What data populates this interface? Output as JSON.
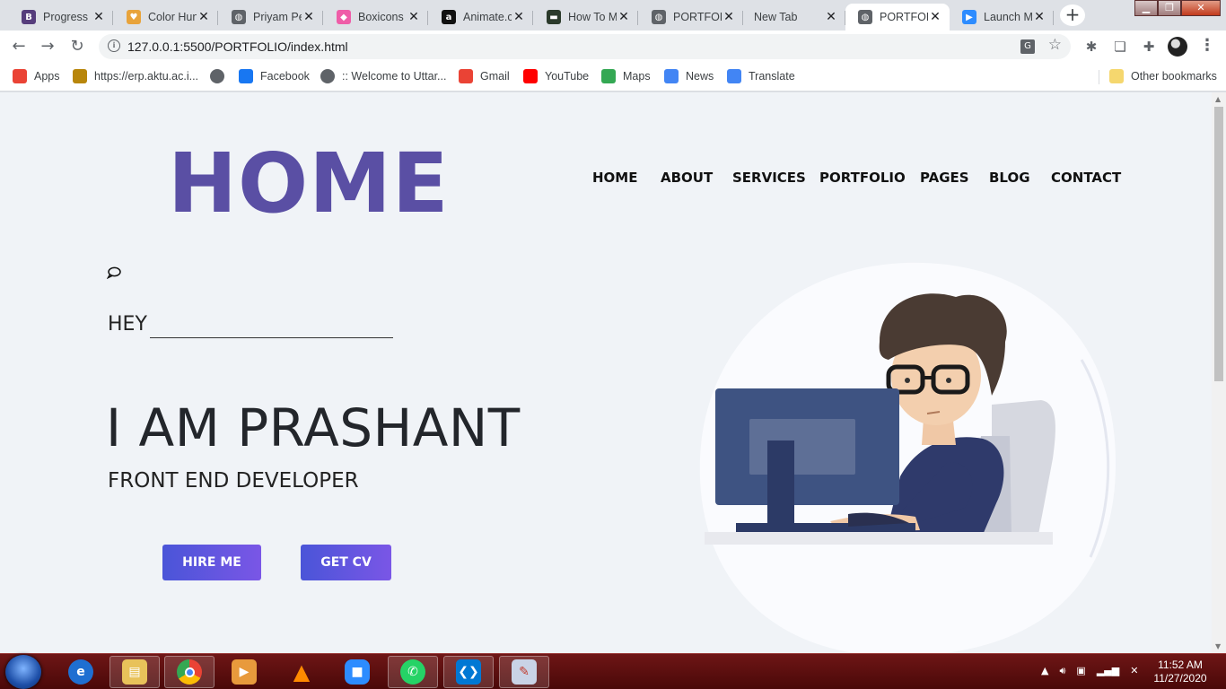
{
  "browser": {
    "tabs": [
      {
        "title": "Progress",
        "icon": "bootstrap-icon",
        "color": "#563d7c",
        "glyph": "B"
      },
      {
        "title": "Color Hun",
        "icon": "colorhunt-icon",
        "color": "#e8a33b",
        "glyph": "♥"
      },
      {
        "title": "Priyam Pe",
        "icon": "globe-icon",
        "color": "#5f6368",
        "glyph": "◍"
      },
      {
        "title": "Boxicons",
        "icon": "boxicons-icon",
        "color": "#ef5da8",
        "glyph": "◆"
      },
      {
        "title": "Animate.c",
        "icon": "animate-icon",
        "color": "#111111",
        "glyph": "a"
      },
      {
        "title": "How To M",
        "icon": "terminal-icon",
        "color": "#2b3a2b",
        "glyph": "▬"
      },
      {
        "title": "PORTFOL",
        "icon": "globe-icon",
        "color": "#5f6368",
        "glyph": "◍"
      },
      {
        "title": "New Tab",
        "icon": "",
        "color": "",
        "glyph": ""
      },
      {
        "title": "PORTFOL",
        "icon": "globe-icon",
        "color": "#5f6368",
        "glyph": "◍",
        "active": true
      },
      {
        "title": "Launch M",
        "icon": "zoom-icon",
        "color": "#2d8cff",
        "glyph": "▶"
      }
    ],
    "new_tab": "+",
    "url": "127.0.0.1:5500/PORTFOLIO/index.html",
    "bookmarks": [
      {
        "label": "Apps",
        "icon": "apps-grid-icon",
        "color": "#ea4335"
      },
      {
        "label": "https://erp.aktu.ac.i...",
        "icon": "aktu-icon",
        "color": "#b8860b"
      },
      {
        "label": "",
        "icon": "globe-icon",
        "color": "#5f6368"
      },
      {
        "label": "Facebook",
        "icon": "facebook-icon",
        "color": "#1877f2"
      },
      {
        "label": ":: Welcome to Uttar...",
        "icon": "globe-icon",
        "color": "#5f6368"
      },
      {
        "label": "Gmail",
        "icon": "gmail-icon",
        "color": "#ea4335"
      },
      {
        "label": "YouTube",
        "icon": "youtube-icon",
        "color": "#ff0000"
      },
      {
        "label": "Maps",
        "icon": "maps-icon",
        "color": "#34a853"
      },
      {
        "label": "News",
        "icon": "news-icon",
        "color": "#4285f4"
      },
      {
        "label": "Translate",
        "icon": "translate-icon",
        "color": "#4285f4"
      }
    ],
    "other_bookmarks": "Other bookmarks"
  },
  "page": {
    "logo": "HOME",
    "nav": [
      "HOME",
      "ABOUT",
      "SERVICES",
      "PORTFOLIO",
      "PAGES",
      "BLOG",
      "CONTACT"
    ],
    "greeting": "HEY",
    "headline": "I AM PRASHANT",
    "subheadline": "FRONT END DEVELOPER",
    "buttons": {
      "hire": "HIRE ME",
      "cv": "GET CV"
    },
    "colors": {
      "logo": "#5a4fa4",
      "button_start": "#4a55d8",
      "button_end": "#7a56e6",
      "background": "#f0f3f7"
    }
  },
  "taskbar": {
    "time": "11:52 AM",
    "date": "11/27/2020"
  }
}
